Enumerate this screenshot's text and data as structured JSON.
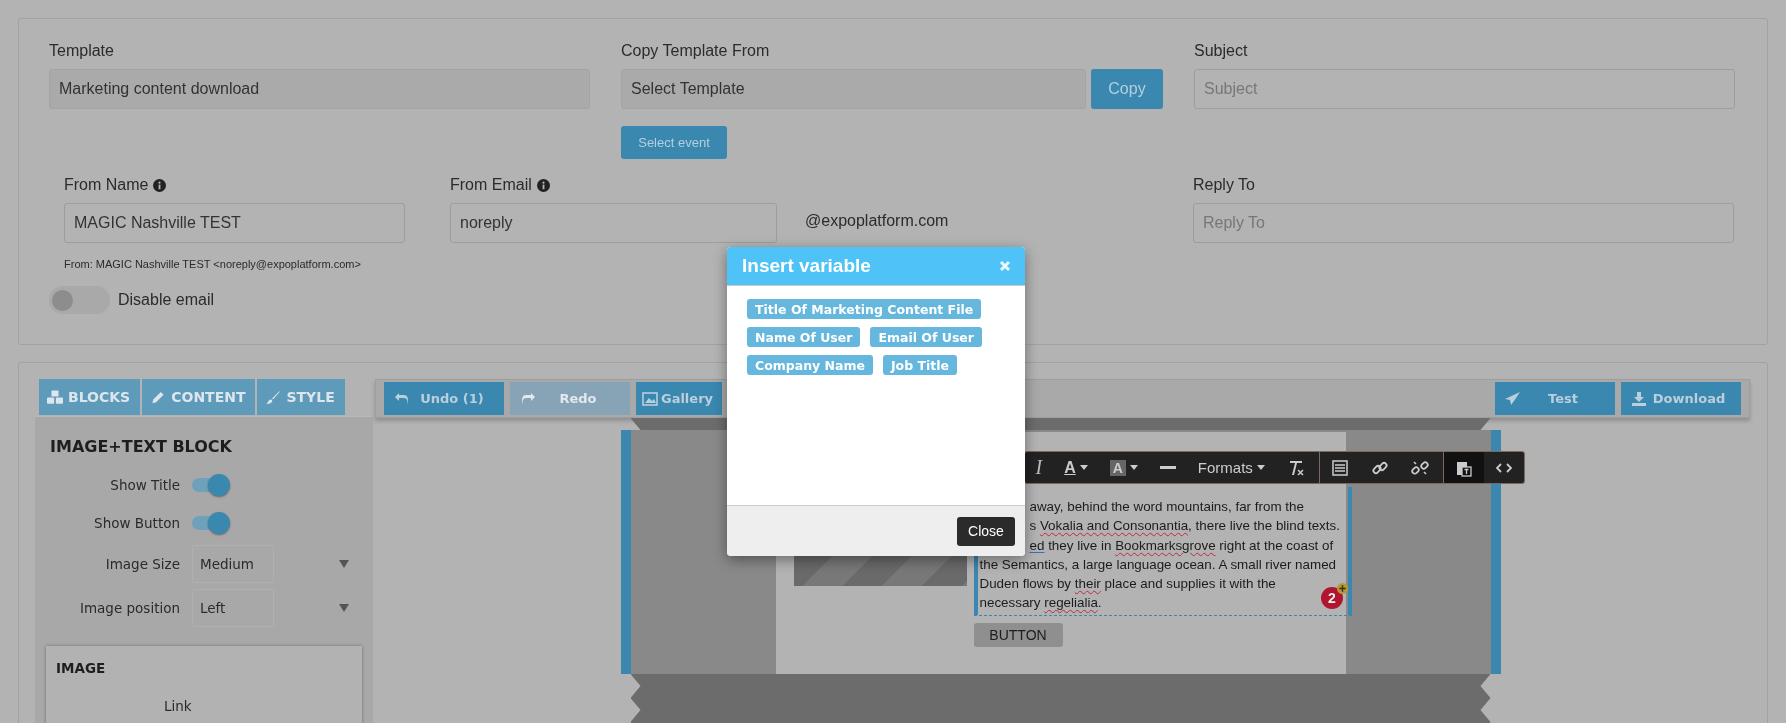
{
  "template": {
    "label": "Template",
    "value": "Marketing content download"
  },
  "copy_template": {
    "label": "Copy Template From",
    "value": "Select Template",
    "button": "Copy"
  },
  "select_event": "Select event",
  "subject": {
    "label": "Subject",
    "placeholder": "Subject"
  },
  "from_name": {
    "label": "From Name",
    "value": "MAGIC Nashville TEST",
    "hint": "From: MAGIC Nashville TEST <noreply@expoplatform.com>"
  },
  "from_email": {
    "label": "From Email",
    "value": "noreply",
    "domain": "@expoplatform.com"
  },
  "reply_to": {
    "label": "Reply To",
    "placeholder": "Reply To"
  },
  "disable_email": {
    "label": "Disable email",
    "on": false
  },
  "panel_tabs": [
    {
      "kind": "blocks",
      "label": "BLOCKS"
    },
    {
      "kind": "content",
      "label": "CONTENT"
    },
    {
      "kind": "style",
      "label": "STYLE"
    }
  ],
  "block_settings": {
    "title": "IMAGE+TEXT BLOCK",
    "rows": [
      {
        "kind": "toggle",
        "label": "Show Title",
        "on": true
      },
      {
        "kind": "toggle",
        "label": "Show Button",
        "on": true
      },
      {
        "kind": "select",
        "label": "Image Size",
        "value": "Medium"
      },
      {
        "kind": "select",
        "label": "Image position",
        "value": "Left"
      }
    ]
  },
  "image_section": {
    "title": "IMAGE",
    "fields": [
      "Link"
    ]
  },
  "toolbar": {
    "left": [
      {
        "kind": "undo",
        "label": "Undo (1)",
        "disabled": false
      },
      {
        "kind": "redo",
        "label": "Redo",
        "disabled": true
      },
      {
        "kind": "gallery",
        "label": "Gallery",
        "disabled": false
      }
    ],
    "right": [
      {
        "kind": "test",
        "label": "Test"
      },
      {
        "kind": "download",
        "label": "Download"
      }
    ]
  },
  "editor": {
    "tools": [
      {
        "kind": "italic",
        "label": "I"
      },
      {
        "kind": "color",
        "label": "A"
      },
      {
        "kind": "bgcolor",
        "label": "A"
      },
      {
        "kind": "hr"
      },
      {
        "kind": "formats",
        "label": "Formats"
      },
      {
        "kind": "clear"
      },
      {
        "kind": "template"
      },
      {
        "kind": "link"
      },
      {
        "kind": "unlink"
      },
      {
        "kind": "paste"
      },
      {
        "kind": "code"
      }
    ],
    "lines": [
      {
        "kind": "clipped",
        "segments": [
          {
            "text": "away, behind the word mountains, far from the"
          }
        ]
      },
      {
        "kind": "clipped",
        "segments": [
          {
            "text": "s "
          },
          {
            "text": "Vokalia and Consonantia",
            "misspelled": true
          },
          {
            "text": ", there live the blind texts."
          }
        ]
      },
      {
        "kind": "clipped",
        "segments": [
          {
            "text": "ed",
            "grammar_flag": true
          },
          {
            "text": " they live in "
          },
          {
            "text": "Bookmarksgrove",
            "misspelled": true
          },
          {
            "text": " right at the coast of"
          }
        ]
      },
      {
        "kind": "full",
        "segments": [
          {
            "text": "the Semantics, a large language ocean. A small river named"
          }
        ]
      },
      {
        "kind": "full",
        "segments": [
          {
            "text": "Duden flows by "
          },
          {
            "text": "their",
            "misspelled": true
          },
          {
            "text": " place and supplies it with the"
          }
        ]
      },
      {
        "kind": "full",
        "segments": [
          {
            "text": "necessary "
          },
          {
            "text": "regelialia",
            "misspelled": true
          },
          {
            "text": "."
          }
        ]
      }
    ],
    "badge": "2",
    "button": "BUTTON"
  },
  "modal": {
    "title": "Insert variable",
    "variables": [
      [
        "Title Of Marketing Content File"
      ],
      [
        "Name Of User",
        "Email Of User"
      ],
      [
        "Company Name",
        "Job Title"
      ]
    ],
    "close": "Close"
  }
}
